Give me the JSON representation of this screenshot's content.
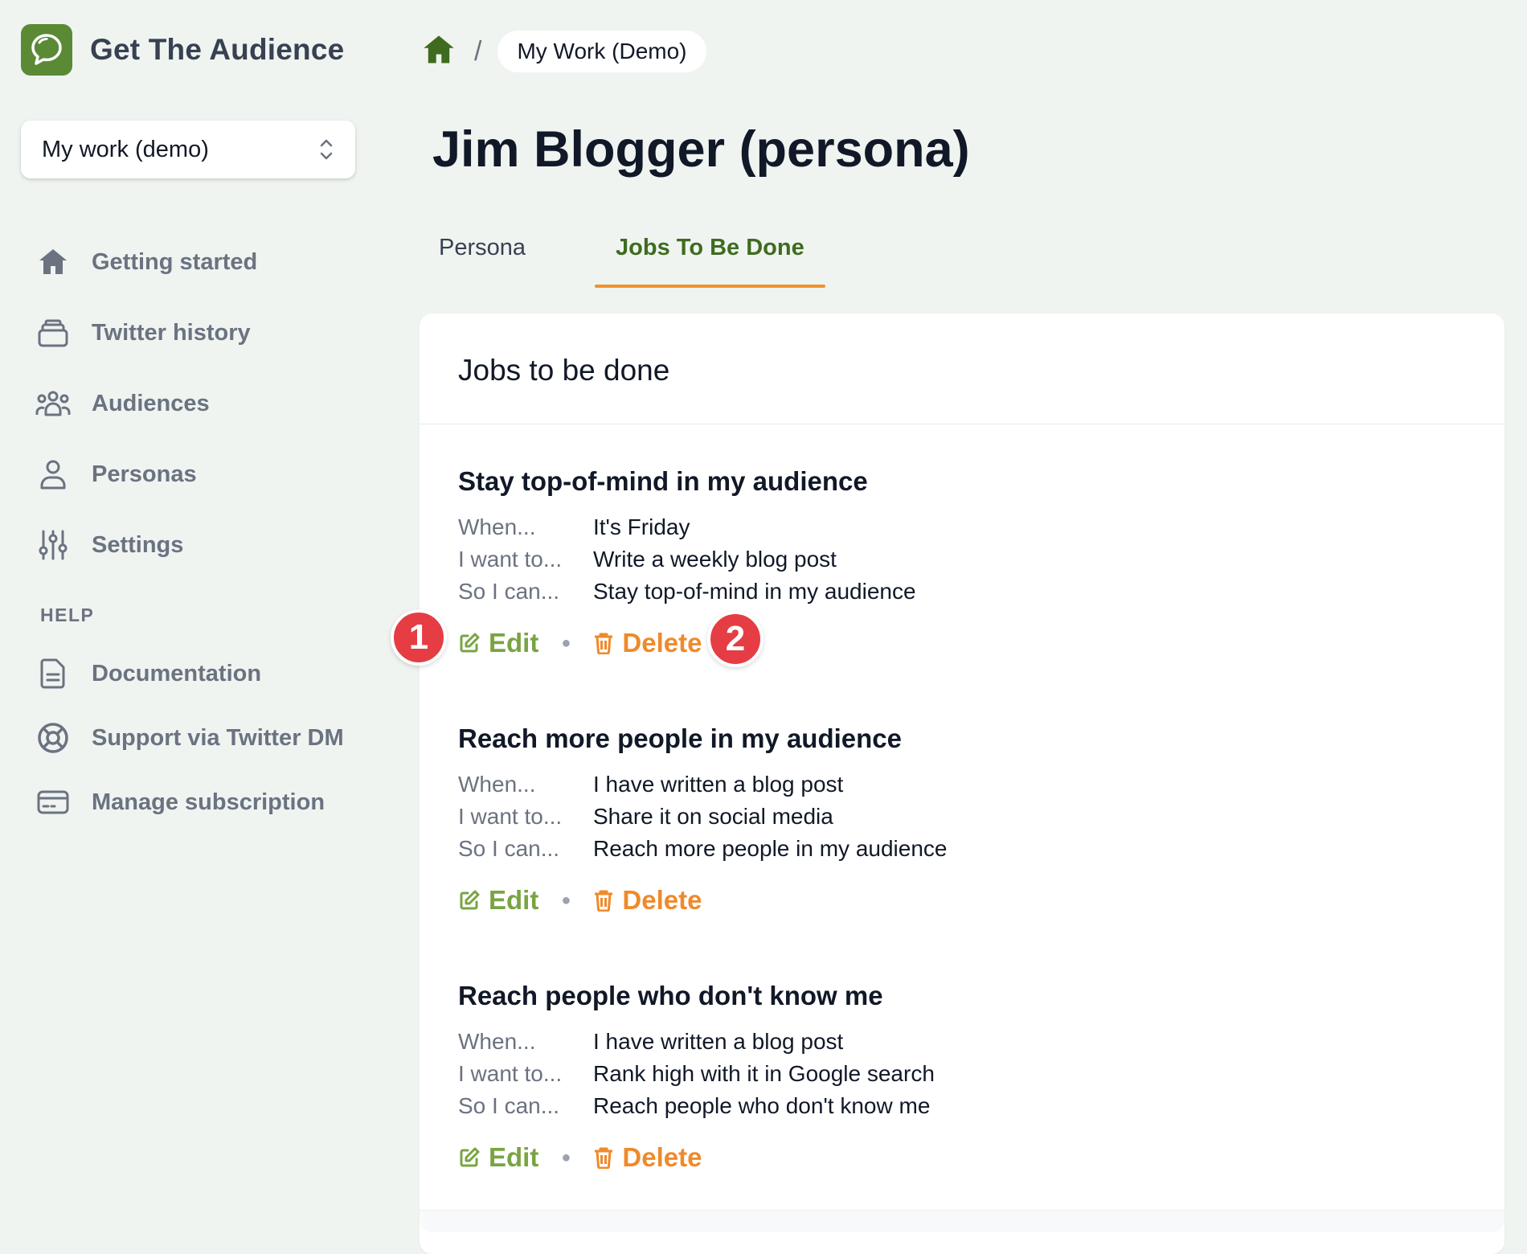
{
  "brand": {
    "name": "Get The Audience",
    "logo_icon": "chat-bubble-icon",
    "color": "#5b8a35"
  },
  "workspace": {
    "label": "My work (demo)"
  },
  "nav": {
    "items": [
      {
        "label": "Getting started",
        "icon": "home-icon"
      },
      {
        "label": "Twitter history",
        "icon": "archive-icon"
      },
      {
        "label": "Audiences",
        "icon": "group-icon"
      },
      {
        "label": "Personas",
        "icon": "user-icon"
      },
      {
        "label": "Settings",
        "icon": "sliders-icon"
      }
    ],
    "help_title": "HELP",
    "help_items": [
      {
        "label": "Documentation",
        "icon": "document-icon"
      },
      {
        "label": "Support via Twitter DM",
        "icon": "lifebuoy-icon"
      },
      {
        "label": "Manage subscription",
        "icon": "credit-card-icon"
      }
    ]
  },
  "breadcrumb": {
    "separator": "/",
    "current": "My Work (Demo)"
  },
  "page": {
    "title": "Jim Blogger (persona)"
  },
  "tabs": [
    {
      "label": "Persona",
      "active": false
    },
    {
      "label": "Jobs To Be Done",
      "active": true
    }
  ],
  "card": {
    "title": "Jobs to be done",
    "labels": {
      "when": "When...",
      "want": "I want to...",
      "so": "So I can..."
    },
    "actions": {
      "edit": "Edit",
      "delete": "Delete"
    },
    "jobs": [
      {
        "title": "Stay top-of-mind in my audience",
        "when": "It's Friday",
        "want": "Write a weekly blog post",
        "so": "Stay top-of-mind in my audience"
      },
      {
        "title": "Reach more people in my audience",
        "when": "I have written a blog post",
        "want": "Share it on social media",
        "so": "Reach more people in my audience"
      },
      {
        "title": "Reach people who don't know me",
        "when": "I have written a blog post",
        "want": "Rank high with it in Google search",
        "so": "Reach people who don't know me"
      }
    ]
  },
  "markers": {
    "first": "1",
    "second": "2"
  },
  "colors": {
    "accent_green": "#3f6b1f",
    "edit_green": "#79a442",
    "delete_orange": "#ef8a2a",
    "marker_red": "#e53d43",
    "tab_underline": "#f0932b"
  }
}
